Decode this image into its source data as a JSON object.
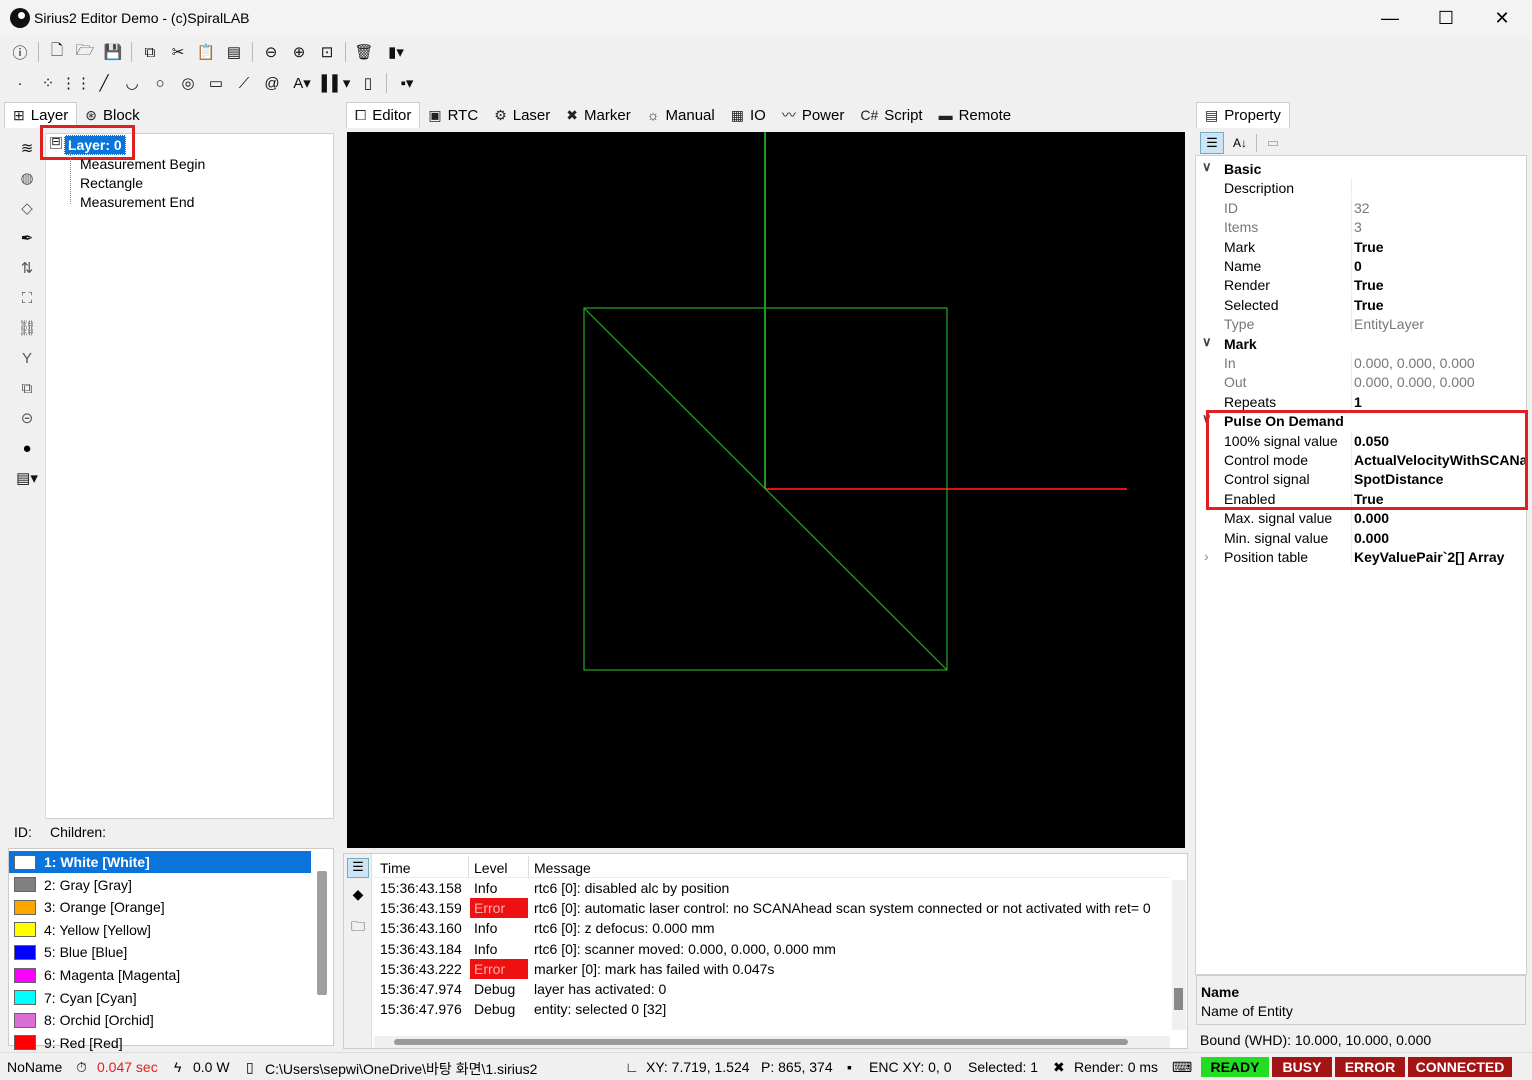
{
  "window": {
    "title": "Sirius2 Editor Demo - (c)SpiralLAB",
    "minimize": "—",
    "maximize": "☐",
    "close": "✕"
  },
  "left_tabs": [
    {
      "label": "Layer",
      "icon": "layer-tree-icon"
    },
    {
      "label": "Block",
      "icon": "block-icon"
    }
  ],
  "tree": {
    "root": "Layer: 0",
    "root_toggle": "⊟",
    "children": [
      "Measurement Begin",
      "Rectangle",
      "Measurement End"
    ]
  },
  "id_children_label": {
    "id": "ID:",
    "children": "Children:"
  },
  "center_tabs": [
    {
      "label": "Editor",
      "icon": "editor-icon"
    },
    {
      "label": "RTC",
      "icon": "rtc-icon"
    },
    {
      "label": "Laser",
      "icon": "laser-icon"
    },
    {
      "label": "Marker",
      "icon": "marker-icon"
    },
    {
      "label": "Manual",
      "icon": "manual-icon"
    },
    {
      "label": "IO",
      "icon": "io-icon"
    },
    {
      "label": "Power",
      "icon": "power-icon"
    },
    {
      "label": "Script",
      "icon": "script-icon"
    },
    {
      "label": "Remote",
      "icon": "remote-icon"
    }
  ],
  "property": {
    "tab_label": "Property",
    "categories": {
      "basic": "Basic",
      "mark": "Mark",
      "pod": "Pulse On Demand"
    },
    "basic_rows": [
      {
        "k": "Description",
        "v": ""
      },
      {
        "k": "ID",
        "v": "32"
      },
      {
        "k": "Items",
        "v": "3"
      },
      {
        "k": "Mark",
        "v": "True"
      },
      {
        "k": "Name",
        "v": "0"
      },
      {
        "k": "Render",
        "v": "True"
      },
      {
        "k": "Selected",
        "v": "True"
      },
      {
        "k": "Type",
        "v": "EntityLayer"
      }
    ],
    "mark_rows": [
      {
        "k": "In",
        "v": "0.000, 0.000, 0.000"
      },
      {
        "k": "Out",
        "v": "0.000, 0.000, 0.000"
      },
      {
        "k": "Repeats",
        "v": "1"
      }
    ],
    "pod_rows": [
      {
        "k": "100% signal value",
        "v": "0.050"
      },
      {
        "k": "Control mode",
        "v": "ActualVelocityWithSCANa"
      },
      {
        "k": "Control signal",
        "v": "SpotDistance"
      },
      {
        "k": "Enabled",
        "v": "True"
      },
      {
        "k": "Max. signal value",
        "v": "0.000"
      },
      {
        "k": "Min. signal value",
        "v": "0.000"
      },
      {
        "k": "Position table",
        "v": "KeyValuePair`2[] Array"
      }
    ],
    "help_title": "Name",
    "help_text": "Name of Entity",
    "bound": "Bound (WHD): 10.000, 10.000, 0.000"
  },
  "colors": [
    {
      "label": "1: White [White]",
      "hex": "#ffffff"
    },
    {
      "label": "2: Gray [Gray]",
      "hex": "#808080"
    },
    {
      "label": "3: Orange [Orange]",
      "hex": "#ffa500"
    },
    {
      "label": "4: Yellow [Yellow]",
      "hex": "#ffff00"
    },
    {
      "label": "5: Blue [Blue]",
      "hex": "#0000ff"
    },
    {
      "label": "6: Magenta [Magenta]",
      "hex": "#ff00ff"
    },
    {
      "label": "7: Cyan [Cyan]",
      "hex": "#00ffff"
    },
    {
      "label": "8: Orchid [Orchid]",
      "hex": "#da70d6"
    },
    {
      "label": "9: Red [Red]",
      "hex": "#ff0000"
    }
  ],
  "log": {
    "headers": {
      "time": "Time",
      "level": "Level",
      "message": "Message"
    },
    "rows": [
      {
        "time": "15:36:43.158",
        "level": "Info",
        "msg": "rtc6 [0]: disabled alc by position"
      },
      {
        "time": "15:36:43.159",
        "level": "Error",
        "msg": "rtc6 [0]: automatic laser control: no SCANAhead scan system connected or not activated  with ret= 0"
      },
      {
        "time": "15:36:43.160",
        "level": "Info",
        "msg": "rtc6 [0]: z defocus: 0.000 mm"
      },
      {
        "time": "15:36:43.184",
        "level": "Info",
        "msg": "rtc6 [0]: scanner moved: 0.000, 0.000, 0.000 mm"
      },
      {
        "time": "15:36:43.222",
        "level": "Error",
        "msg": "marker [0]: mark has failed with 0.047s"
      },
      {
        "time": "15:36:47.974",
        "level": "Debug",
        "msg": "layer has activated: 0"
      },
      {
        "time": "15:36:47.976",
        "level": "Debug",
        "msg": "entity: selected 0 [32]"
      }
    ]
  },
  "status": {
    "name": "NoName",
    "time": "0.047 sec",
    "power": "0.0 W",
    "path": "C:\\Users\\sepwi\\OneDrive\\바탕 화면\\1.sirius2",
    "xy": "XY: 7.719, 1.524",
    "p": "P: 865, 374",
    "enc": "ENC XY: 0, 0",
    "selected": "Selected: 1",
    "render": "Render: 0 ms",
    "ready": "READY",
    "busy": "BUSY",
    "error": "ERROR",
    "connected": "CONNECTED"
  },
  "accent": {
    "selection": "#0a74da",
    "error_red": "#e02020",
    "ready_green": "#22cc22",
    "dark_red": "#a31515"
  }
}
